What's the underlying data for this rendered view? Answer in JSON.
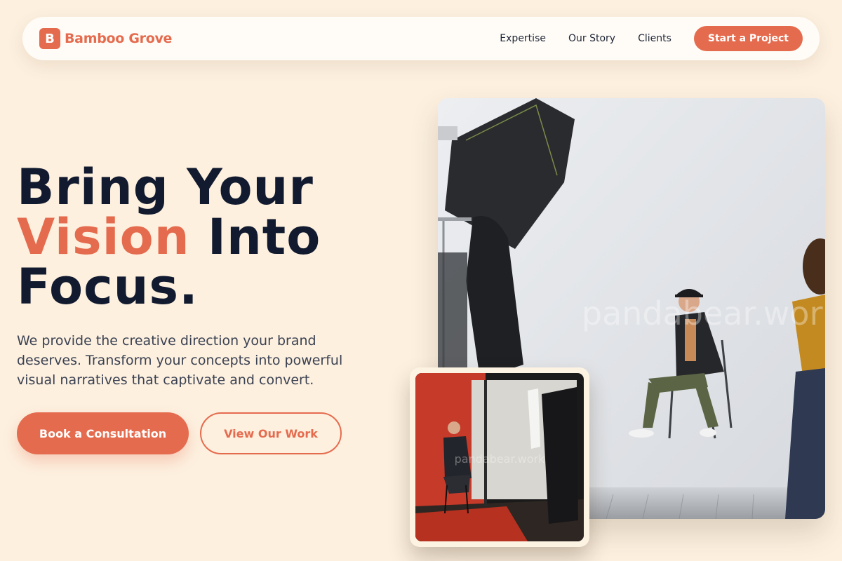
{
  "brand": {
    "badge_letter": "B",
    "name": "Bamboo Grove",
    "color": "#e56b4e"
  },
  "nav": {
    "links": [
      "Expertise",
      "Our Story",
      "Clients"
    ],
    "cta_label": "Start a Project"
  },
  "hero": {
    "title_line1": "Bring Your",
    "title_accent": "Vision",
    "title_line2_rest": " Into",
    "title_line3": "Focus.",
    "description_line1": "We provide the creative direction your brand",
    "description_line2": "deserves. Transform your concepts into powerful",
    "description_line3": "visual narratives that captivate and convert.",
    "primary_button": "Book a Consultation",
    "secondary_button": "View Our Work"
  },
  "images": {
    "main_watermark": "pandabear.work",
    "inset_watermark": "pandabear.work"
  },
  "colors": {
    "background": "#fdf0df",
    "accent": "#e56b4e",
    "heading": "#111a2e",
    "body_text": "#3a4152"
  }
}
